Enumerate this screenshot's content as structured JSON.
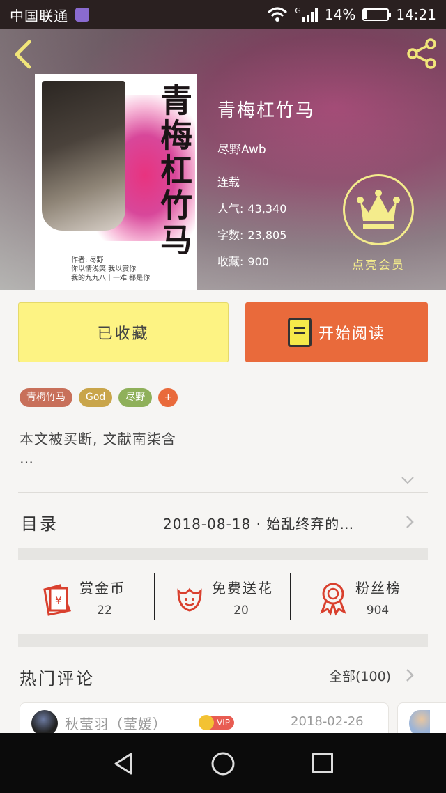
{
  "status_bar": {
    "carrier": "中国联通",
    "network": "G",
    "battery_percent": "14%",
    "battery_level": 0.14,
    "time": "14:21"
  },
  "book": {
    "title": "青梅杠竹马",
    "author": "尽野Awb",
    "status": "连载",
    "popularity_label": "人气:",
    "popularity": "43,340",
    "word_count_label": "字数:",
    "word_count": "23,805",
    "favorites_label": "收藏:",
    "favorites": "900",
    "cover": {
      "title": "青梅杠竹马",
      "author_line": "作者: 尽野",
      "line1": "你以情浅笑 我以赏你",
      "line2": "我的九九八十一难 都是你"
    }
  },
  "membership": {
    "label": "点亮会员",
    "icon": "crown-icon",
    "color": "#f4ec8c"
  },
  "actions": {
    "collected_label": "已收藏",
    "read_label": "开始阅读",
    "read_color": "#e96a3b",
    "collected_color": "#fdf383"
  },
  "tags": [
    {
      "label": "青梅竹马",
      "color": "#c8705a"
    },
    {
      "label": "God",
      "color": "#c9a54a"
    },
    {
      "label": "尽野",
      "color": "#8fb05a"
    },
    {
      "label": "+",
      "color": "#e96a3b"
    }
  ],
  "synopsis": {
    "text": "本文被买断, 文献南柒含",
    "more": "…"
  },
  "catalog": {
    "label": "目录",
    "latest": "2018-08-18 · 始乱终弃的…"
  },
  "stats": [
    {
      "label": "赏金币",
      "value": "22",
      "icon": "red-envelope-icon"
    },
    {
      "label": "免费送花",
      "value": "20",
      "icon": "flower-icon"
    },
    {
      "label": "粉丝榜",
      "value": "904",
      "icon": "medal-icon"
    }
  ],
  "comments": {
    "title": "热门评论",
    "all_label": "全部(100)",
    "items": [
      {
        "user": "秋莹羽（莹媛）",
        "badge": "VIP",
        "date": "2018-02-26"
      }
    ]
  }
}
